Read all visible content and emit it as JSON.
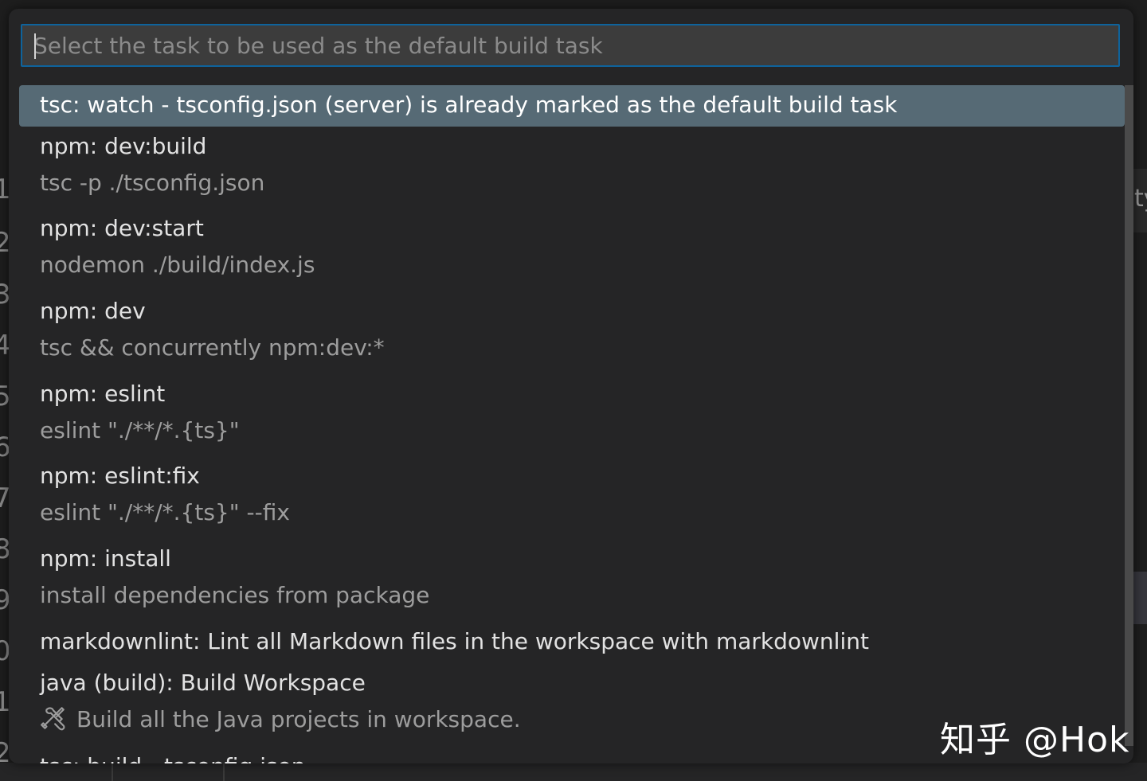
{
  "quick_pick": {
    "placeholder": "Select the task to be used as the default build task",
    "items": [
      {
        "label": "tsc: watch - tsconfig.json (server) is already marked as the default build task",
        "detail": ""
      },
      {
        "label": "npm: dev:build",
        "detail": "tsc -p ./tsconfig.json"
      },
      {
        "label": "npm: dev:start",
        "detail": "nodemon ./build/index.js"
      },
      {
        "label": "npm: dev",
        "detail": "tsc && concurrently npm:dev:*"
      },
      {
        "label": "npm: eslint",
        "detail": "eslint \"./**/*.{ts}\""
      },
      {
        "label": "npm: eslint:fix",
        "detail": "eslint \"./**/*.{ts}\" --fix"
      },
      {
        "label": "npm: install",
        "detail": "install dependencies from package"
      },
      {
        "label": "markdownlint: Lint all Markdown files in the workspace with markdownlint",
        "detail": ""
      },
      {
        "label": "java (build): Build Workspace",
        "detail": "Build all the Java projects in workspace.",
        "icon": "tools-icon"
      },
      {
        "label": "tsc: build - tsconfig.json",
        "detail": ""
      }
    ]
  },
  "watermark": "知乎 @Hok",
  "colors": {
    "selection": "#566a75",
    "focus_border": "#0e639c",
    "widget_background": "#252526"
  }
}
